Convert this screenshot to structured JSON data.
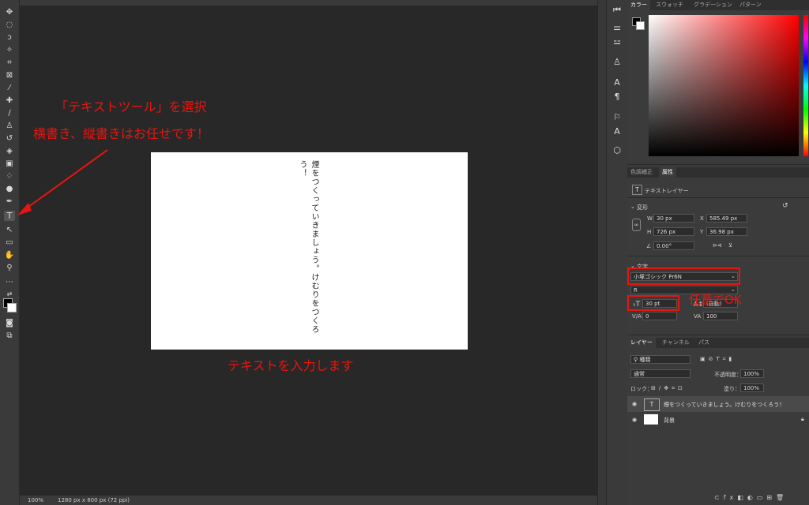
{
  "annotations": {
    "select_tool": "「テキストツール」を選択",
    "direction": "横書き、縦書きはお任せです！",
    "input_text": "テキストを入力します",
    "any_ok": "任意でOK"
  },
  "document": {
    "vertical_text": "煙をつくっていきましょう。けむりをつくろう！"
  },
  "status": {
    "zoom": "100%",
    "doc_info": "1280 px x 800 px (72 ppi)"
  },
  "color_panel": {
    "tabs": [
      "カラー",
      "スウォッチ",
      "グラデーション",
      "パターン"
    ]
  },
  "properties": {
    "tabs": [
      "色調補正",
      "属性"
    ],
    "layer_type": "テキストレイヤー",
    "transform_header": "変形",
    "w_label": "W",
    "w_value": "30 px",
    "x_label": "X",
    "x_value": "585.49 px",
    "h_label": "H",
    "h_value": "726 px",
    "y_label": "Y",
    "y_value": "36.98 px",
    "angle": "0.00°",
    "text_header": "文字",
    "font_family": "小塚ゴシック Pr6N",
    "font_style": "R",
    "font_size": "30 pt",
    "leading": "(自動)",
    "tracking": "0",
    "scale": "100"
  },
  "layers": {
    "tabs": [
      "レイヤー",
      "チャンネル",
      "パス"
    ],
    "filter": "種類",
    "blend": "通常",
    "opacity_label": "不透明度：",
    "opacity": "100%",
    "lock_label": "ロック：",
    "fill_label": "塗り：",
    "fill": "100%",
    "items": [
      {
        "name": "煙をつくっていきましょう。けむりをつくろう！",
        "type": "text"
      },
      {
        "name": "背景",
        "type": "background"
      }
    ]
  },
  "colors": {
    "annotation_red": "#e8150f",
    "panel_bg": "#3b3b3b",
    "canvas_bg": "#282828"
  }
}
